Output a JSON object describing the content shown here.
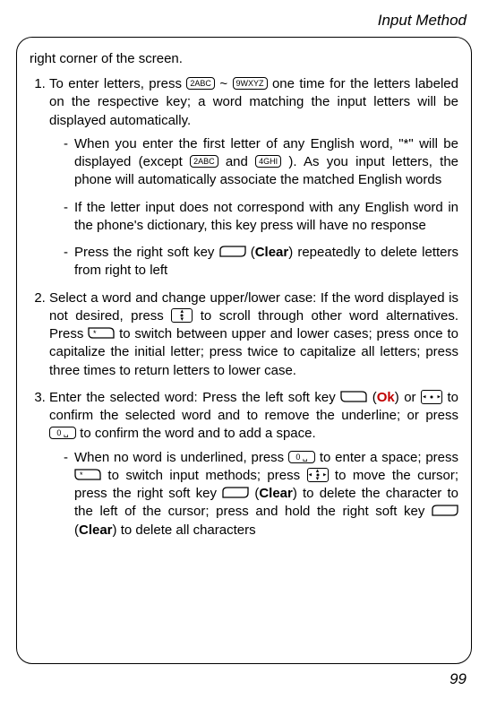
{
  "header": "Input Method",
  "pagenum": "99",
  "lead": "right corner of the screen.",
  "items": {
    "i1": {
      "t1": "To enter letters, press ",
      "t2": " ~ ",
      "t3": " one time for the letters labeled on the respective key; a word matching the input letters will be displayed automatically.",
      "s1a": "When you enter the first letter of any English word, \"*\" will be displayed (except ",
      "s1b": " and ",
      "s1c": "). As you input letters, the phone will automatically associate the matched English words",
      "s2": "If the letter input does not correspond with any English word in the phone's dictionary, this key press will have no response",
      "s3a": "Press the right soft key ",
      "s3b": " (",
      "s3c": ") repeatedly to delete letters from right to left"
    },
    "i2": {
      "t1": "Select a word and change upper/lower case: If the word displayed is not desired, press ",
      "t2": " to scroll through other word alternatives. Press ",
      "t3": " to switch between upper and lower cases; press once to capitalize the initial letter; press twice to capitalize all letters; press three times to return letters to lower case."
    },
    "i3": {
      "t1": "Enter the selected word: Press the left soft key ",
      "t2": " (",
      "t3": ") or ",
      "t4": " to confirm the selected word and to remove the underline; or press ",
      "t5": " to confirm the word and to add a space.",
      "s1a": "When no word is underlined, press ",
      "s1b": " to enter a space; press ",
      "s1c": " to switch input methods; press ",
      "s1d": " to move the cursor; press the right soft key ",
      "s1e": " (",
      "s1f": ") to delete the character to the left of the cursor; press and hold the right soft key ",
      "s1g": " (",
      "s1h": ") to delete all characters"
    }
  },
  "labels": {
    "clear": "Clear",
    "ok": "Ok"
  },
  "keys": {
    "k2": "2ABC",
    "k9": "9WXYZ",
    "k4": "4GHI",
    "k0": "0 ␣",
    "star": "*"
  }
}
